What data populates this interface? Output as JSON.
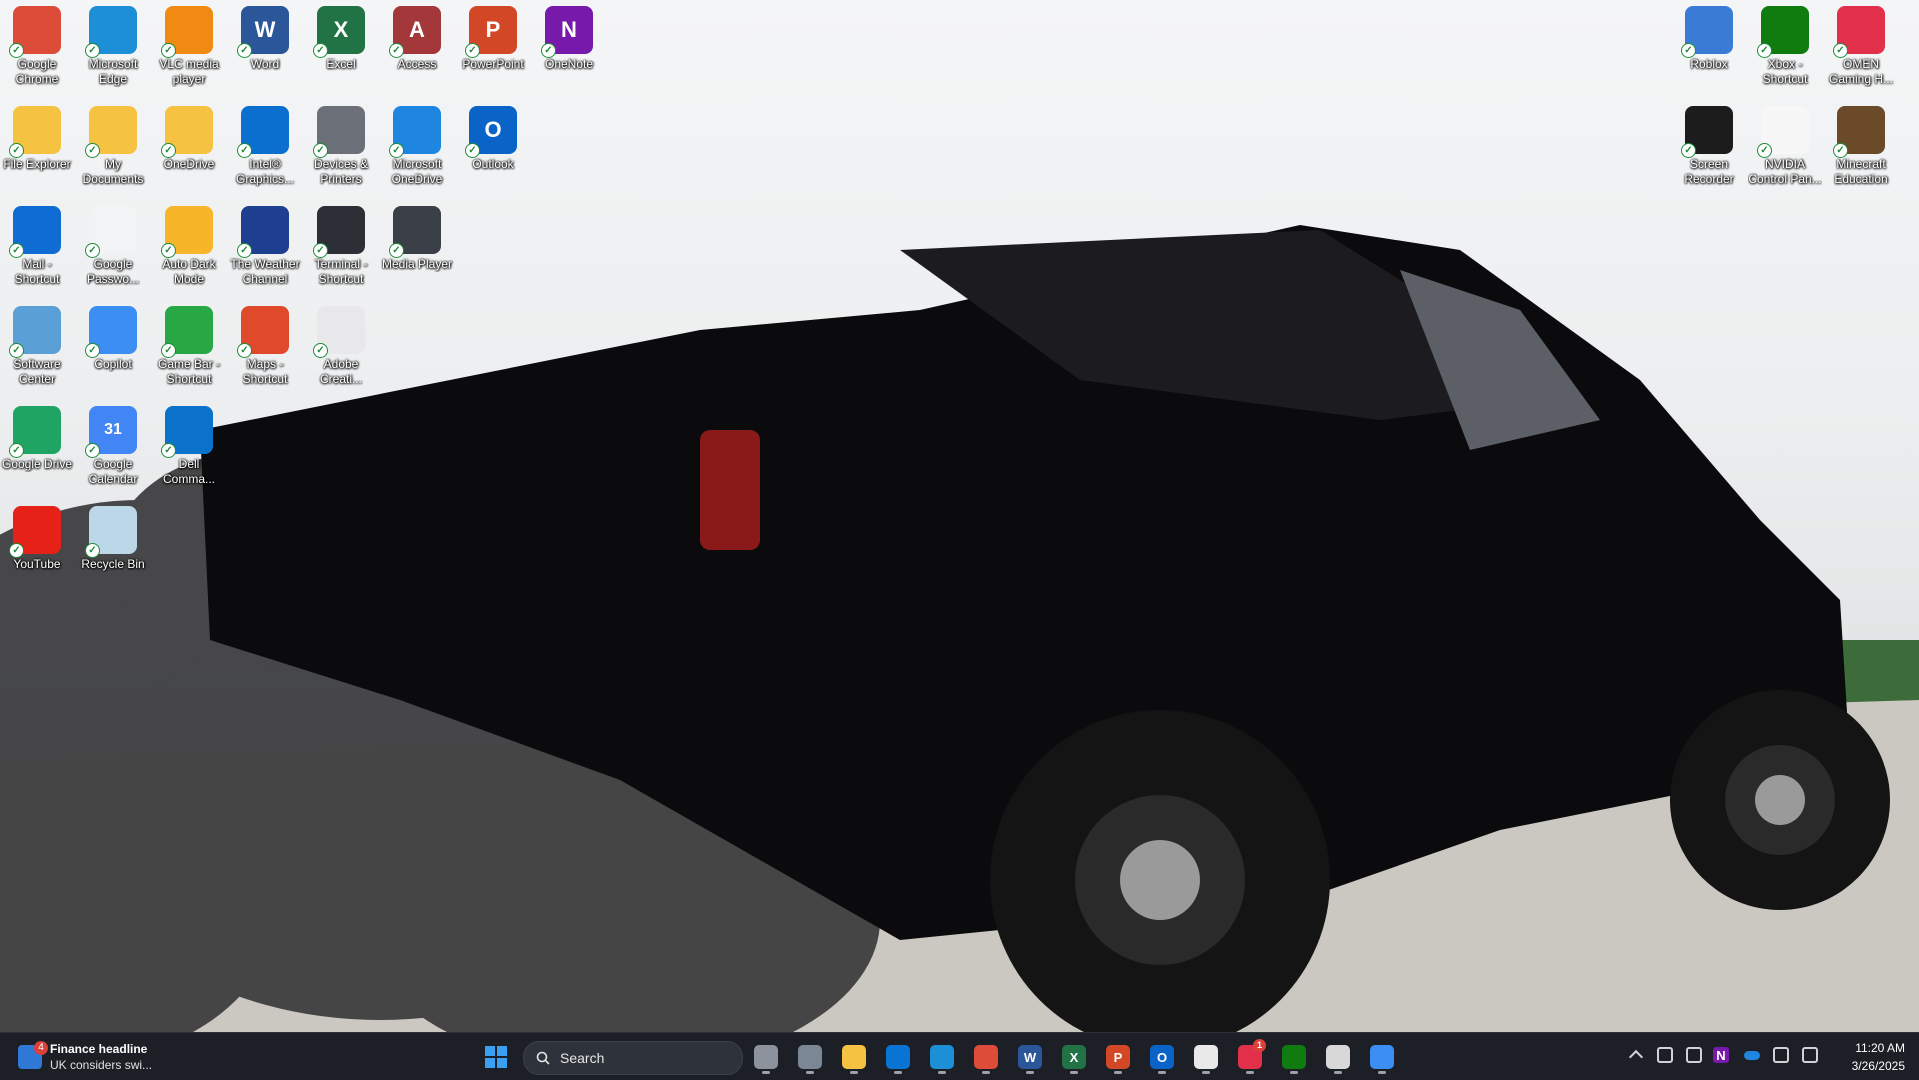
{
  "desktop": {
    "icons": [
      {
        "label": "Google Chrome",
        "icon": "chrome-icon",
        "color": "#dd4b39"
      },
      {
        "label": "Microsoft Edge",
        "icon": "edge-icon",
        "color": "#1d8fd6"
      },
      {
        "label": "VLC media player",
        "icon": "vlc-icon",
        "color": "#f08a12"
      },
      {
        "label": "Word",
        "icon": "word-icon",
        "color": "#2b579a",
        "letter": "W"
      },
      {
        "label": "Excel",
        "icon": "excel-icon",
        "color": "#217346",
        "letter": "X"
      },
      {
        "label": "Access",
        "icon": "access-icon",
        "color": "#a4373a",
        "letter": "A"
      },
      {
        "label": "PowerPoint",
        "icon": "powerpoint-icon",
        "color": "#d24726",
        "letter": "P"
      },
      {
        "label": "OneNote",
        "icon": "onenote-icon",
        "color": "#7719aa",
        "letter": "N"
      },
      {
        "label": "File Explorer",
        "icon": "folder-icon",
        "color": "#f5c242"
      },
      {
        "label": "My Documents",
        "icon": "folder-icon",
        "color": "#f5c242"
      },
      {
        "label": "OneDrive",
        "icon": "onedrive-folder-icon",
        "color": "#f5c242"
      },
      {
        "label": "Intel® Graphics...",
        "icon": "intel-graphics-icon",
        "color": "#0b6fcf"
      },
      {
        "label": "Devices & Printers",
        "icon": "printer-icon",
        "color": "#6b7078"
      },
      {
        "label": "Microsoft OneDrive",
        "icon": "onedrive-icon",
        "color": "#1e86e0"
      },
      {
        "label": "Outlook",
        "icon": "outlook-icon",
        "color": "#0a64c8",
        "letter": "O"
      },
      {
        "label": "Mail - Shortcut",
        "icon": "mail-icon",
        "color": "#0f6cd2"
      },
      {
        "label": "Google Passwo...",
        "icon": "key-icon",
        "color": "#f1f3f4"
      },
      {
        "label": "Auto Dark Mode",
        "icon": "sun-moon-icon",
        "color": "#f7b52a"
      },
      {
        "label": "The Weather Channel",
        "icon": "weather-channel-icon",
        "color": "#1e3e8f"
      },
      {
        "label": "Terminal - Shortcut",
        "icon": "terminal-icon",
        "color": "#2d2f36"
      },
      {
        "label": "Media Player",
        "icon": "media-player-icon",
        "color": "#3a3f48"
      },
      {
        "label": "Software Center",
        "icon": "software-center-icon",
        "color": "#5aa0d6"
      },
      {
        "label": "Copilot",
        "icon": "copilot-icon",
        "color": "#3c8ef2"
      },
      {
        "label": "Game Bar - Shortcut",
        "icon": "game-bar-icon",
        "color": "#28a745"
      },
      {
        "label": "Maps - Shortcut",
        "icon": "maps-icon",
        "color": "#e04a2a"
      },
      {
        "label": "Adobe Creati...",
        "icon": "adobe-icon",
        "color": "#e8e8ea"
      },
      {
        "label": "Google Drive",
        "icon": "google-drive-icon",
        "color": "#1fa463"
      },
      {
        "label": "Google Calendar",
        "icon": "calendar-icon",
        "color": "#4285f4",
        "letter": "31"
      },
      {
        "label": "Dell Comma...",
        "icon": "dell-command-icon",
        "color": "#0a72c9"
      },
      {
        "label": "YouTube",
        "icon": "youtube-icon",
        "color": "#e62117"
      },
      {
        "label": "Recycle Bin",
        "icon": "recycle-bin-icon",
        "color": "#bcd7e8"
      },
      {
        "label": "Roblox",
        "icon": "roblox-icon",
        "color": "#3a7bd5"
      },
      {
        "label": "Xbox - Shortcut",
        "icon": "xbox-icon",
        "color": "#107c10"
      },
      {
        "label": "OMEN Gaming H...",
        "icon": "omen-icon",
        "color": "#e2304b"
      },
      {
        "label": "Screen Recorder Plus",
        "icon": "screen-recorder-icon",
        "color": "#1c1c1c"
      },
      {
        "label": "NVIDIA Control Pan...",
        "icon": "document-icon",
        "color": "#f7f7f7"
      },
      {
        "label": "Minecraft Education",
        "icon": "minecraft-icon",
        "color": "#6b4a2a"
      }
    ]
  },
  "widget": {
    "badge": "4",
    "headline": "Finance headline",
    "subtext": "UK considers swi..."
  },
  "taskbar": {
    "search_placeholder": "Search",
    "apps": [
      {
        "name": "task-view",
        "icon": "task-view-icon",
        "color": "#8d939c"
      },
      {
        "name": "settings",
        "icon": "gear-icon",
        "color": "#7b8794"
      },
      {
        "name": "file-explorer",
        "icon": "folder-icon",
        "color": "#f5c242"
      },
      {
        "name": "microsoft-store",
        "icon": "store-icon",
        "color": "#0a74d4"
      },
      {
        "name": "edge",
        "icon": "edge-icon",
        "color": "#1d8fd6"
      },
      {
        "name": "chrome",
        "icon": "chrome-icon",
        "color": "#dd4b39"
      },
      {
        "name": "word",
        "icon": "word-icon",
        "color": "#2b579a",
        "letter": "W"
      },
      {
        "name": "excel",
        "icon": "excel-icon",
        "color": "#217346",
        "letter": "X"
      },
      {
        "name": "powerpoint",
        "icon": "powerpoint-icon",
        "color": "#d24726",
        "letter": "P"
      },
      {
        "name": "outlook",
        "icon": "outlook-icon",
        "color": "#0a64c8",
        "letter": "O"
      },
      {
        "name": "app-dark",
        "icon": "castle-icon",
        "color": "#e9e9e9"
      },
      {
        "name": "omen",
        "icon": "omen-icon",
        "color": "#e2304b",
        "badge": "1"
      },
      {
        "name": "xbox",
        "icon": "xbox-icon",
        "color": "#107c10"
      },
      {
        "name": "roblox",
        "icon": "roblox-icon",
        "color": "#d8d8d8"
      },
      {
        "name": "copilot-m365",
        "icon": "copilot-icon",
        "color": "#3c8ef2"
      }
    ],
    "tray": [
      {
        "icon": "chevron-up-icon"
      },
      {
        "icon": "printer-plus-icon"
      },
      {
        "icon": "security-icon"
      },
      {
        "icon": "onenote-icon",
        "letter": "N"
      },
      {
        "icon": "onedrive-icon"
      },
      {
        "icon": "network-icon"
      },
      {
        "icon": "speaker-muted-icon"
      }
    ],
    "time": "11:20 AM",
    "date": "3/26/2025"
  }
}
